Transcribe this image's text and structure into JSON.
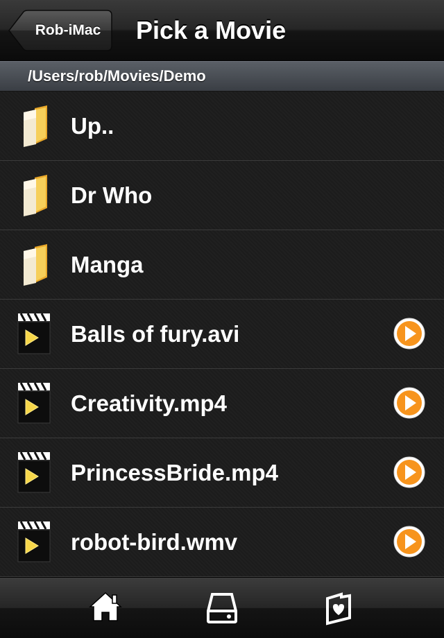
{
  "navbar": {
    "back_label": "Rob-iMac",
    "title": "Pick a Movie"
  },
  "path": "/Users/rob/Movies/Demo",
  "items": [
    {
      "label": "Up..",
      "type": "folder",
      "icon": "folder-icon"
    },
    {
      "label": "Dr Who",
      "type": "folder",
      "icon": "folder-icon"
    },
    {
      "label": "Manga",
      "type": "folder",
      "icon": "folder-icon"
    },
    {
      "label": "Balls of fury.avi",
      "type": "movie",
      "icon": "movie-file-icon",
      "action": "play-icon"
    },
    {
      "label": "Creativity.mp4",
      "type": "movie",
      "icon": "movie-file-icon",
      "action": "play-icon"
    },
    {
      "label": "PrincessBride.mp4",
      "type": "movie",
      "icon": "movie-file-icon",
      "action": "play-icon"
    },
    {
      "label": "robot-bird.wmv",
      "type": "movie",
      "icon": "movie-file-icon",
      "action": "play-icon"
    }
  ],
  "tabbar": {
    "tabs": [
      {
        "icon": "home-icon"
      },
      {
        "icon": "hard-drive-icon"
      },
      {
        "icon": "favorite-folder-icon"
      }
    ]
  },
  "colors": {
    "play_orange": "#f7941d",
    "folder_yellow": "#f3c44a",
    "text": "#ffffff"
  }
}
